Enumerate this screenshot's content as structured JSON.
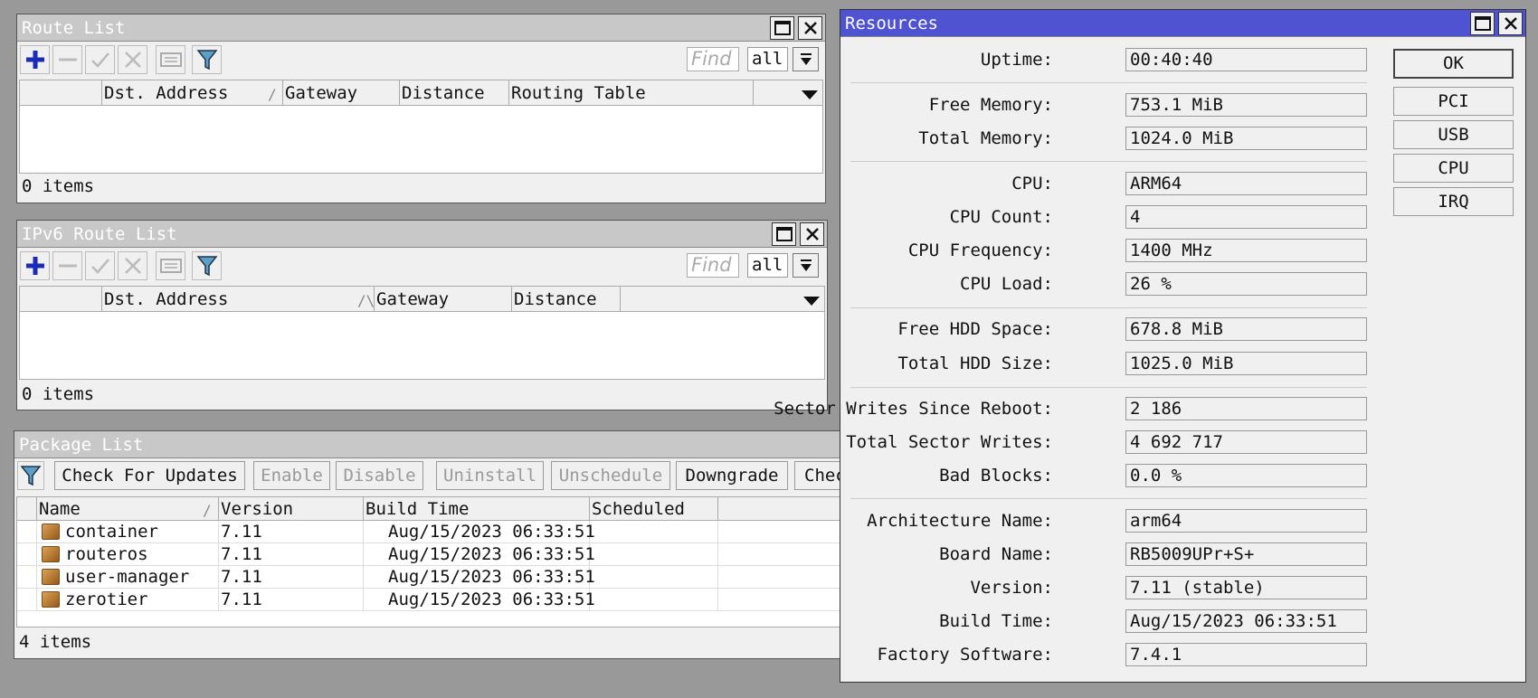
{
  "route_list": {
    "title": "Route List",
    "find_placeholder": "Find",
    "filter_value": "all",
    "columns": [
      "Dst. Address",
      "Gateway",
      "Distance",
      "Routing Table"
    ],
    "status": "0 items"
  },
  "ipv6_route_list": {
    "title": "IPv6 Route List",
    "find_placeholder": "Find",
    "filter_value": "all",
    "columns": [
      "Dst. Address",
      "Gateway",
      "Distance"
    ],
    "status": "0 items"
  },
  "package_list": {
    "title": "Package List",
    "buttons": {
      "check_for_updates": "Check For Updates",
      "enable": "Enable",
      "disable": "Disable",
      "uninstall": "Uninstall",
      "unschedule": "Unschedule",
      "downgrade": "Downgrade",
      "check": "Chec"
    },
    "columns": [
      "Name",
      "Version",
      "Build Time",
      "Scheduled"
    ],
    "rows": [
      {
        "name": "container",
        "version": "7.11",
        "build_time": "Aug/15/2023 06:33:51"
      },
      {
        "name": "routeros",
        "version": "7.11",
        "build_time": "Aug/15/2023 06:33:51"
      },
      {
        "name": "user-manager",
        "version": "7.11",
        "build_time": "Aug/15/2023 06:33:51"
      },
      {
        "name": "zerotier",
        "version": "7.11",
        "build_time": "Aug/15/2023 06:33:51"
      }
    ],
    "status": "4 items"
  },
  "resources": {
    "title": "Resources",
    "fields": {
      "uptime": {
        "label": "Uptime:",
        "value": "00:40:40"
      },
      "free_memory": {
        "label": "Free Memory:",
        "value": "753.1 MiB"
      },
      "total_memory": {
        "label": "Total Memory:",
        "value": "1024.0 MiB"
      },
      "cpu": {
        "label": "CPU:",
        "value": "ARM64"
      },
      "cpu_count": {
        "label": "CPU Count:",
        "value": "4"
      },
      "cpu_frequency": {
        "label": "CPU Frequency:",
        "value": "1400 MHz"
      },
      "cpu_load": {
        "label": "CPU Load:",
        "value": "26 %"
      },
      "free_hdd_space": {
        "label": "Free HDD Space:",
        "value": "678.8 MiB"
      },
      "total_hdd_size": {
        "label": "Total HDD Size:",
        "value": "1025.0 MiB"
      },
      "sector_writes_since_reboot": {
        "label": "Sector Writes Since Reboot:",
        "value": "2 186"
      },
      "total_sector_writes": {
        "label": "Total Sector Writes:",
        "value": "4 692 717"
      },
      "bad_blocks": {
        "label": "Bad Blocks:",
        "value": "0.0 %"
      },
      "architecture_name": {
        "label": "Architecture Name:",
        "value": "arm64"
      },
      "board_name": {
        "label": "Board Name:",
        "value": "RB5009UPr+S+"
      },
      "version": {
        "label": "Version:",
        "value": "7.11 (stable)"
      },
      "build_time": {
        "label": "Build Time:",
        "value": "Aug/15/2023 06:33:51"
      },
      "factory_software": {
        "label": "Factory Software:",
        "value": "7.4.1"
      }
    },
    "buttons": {
      "ok": "OK",
      "pci": "PCI",
      "usb": "USB",
      "cpu": "CPU",
      "irq": "IRQ"
    }
  }
}
